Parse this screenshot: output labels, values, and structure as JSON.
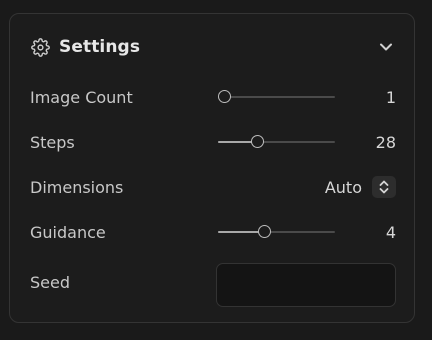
{
  "header": {
    "title": "Settings",
    "icon": "gear-icon",
    "toggle_icon": "chevron-down-icon"
  },
  "rows": {
    "image_count": {
      "label": "Image Count",
      "value": "1",
      "slider_fraction": 0.0
    },
    "steps": {
      "label": "Steps",
      "value": "28",
      "slider_fraction": 0.3
    },
    "dimensions": {
      "label": "Dimensions",
      "value": "Auto",
      "icon": "chevron-up-down-icon"
    },
    "guidance": {
      "label": "Guidance",
      "value": "4",
      "slider_fraction": 0.36
    },
    "seed": {
      "label": "Seed",
      "value": "",
      "placeholder": ""
    }
  },
  "colors": {
    "background": "#1a1a1a",
    "panel": "#1c1c1c",
    "border": "#343434",
    "text": "#c8c8c8",
    "accent": "#bdbdbd"
  }
}
